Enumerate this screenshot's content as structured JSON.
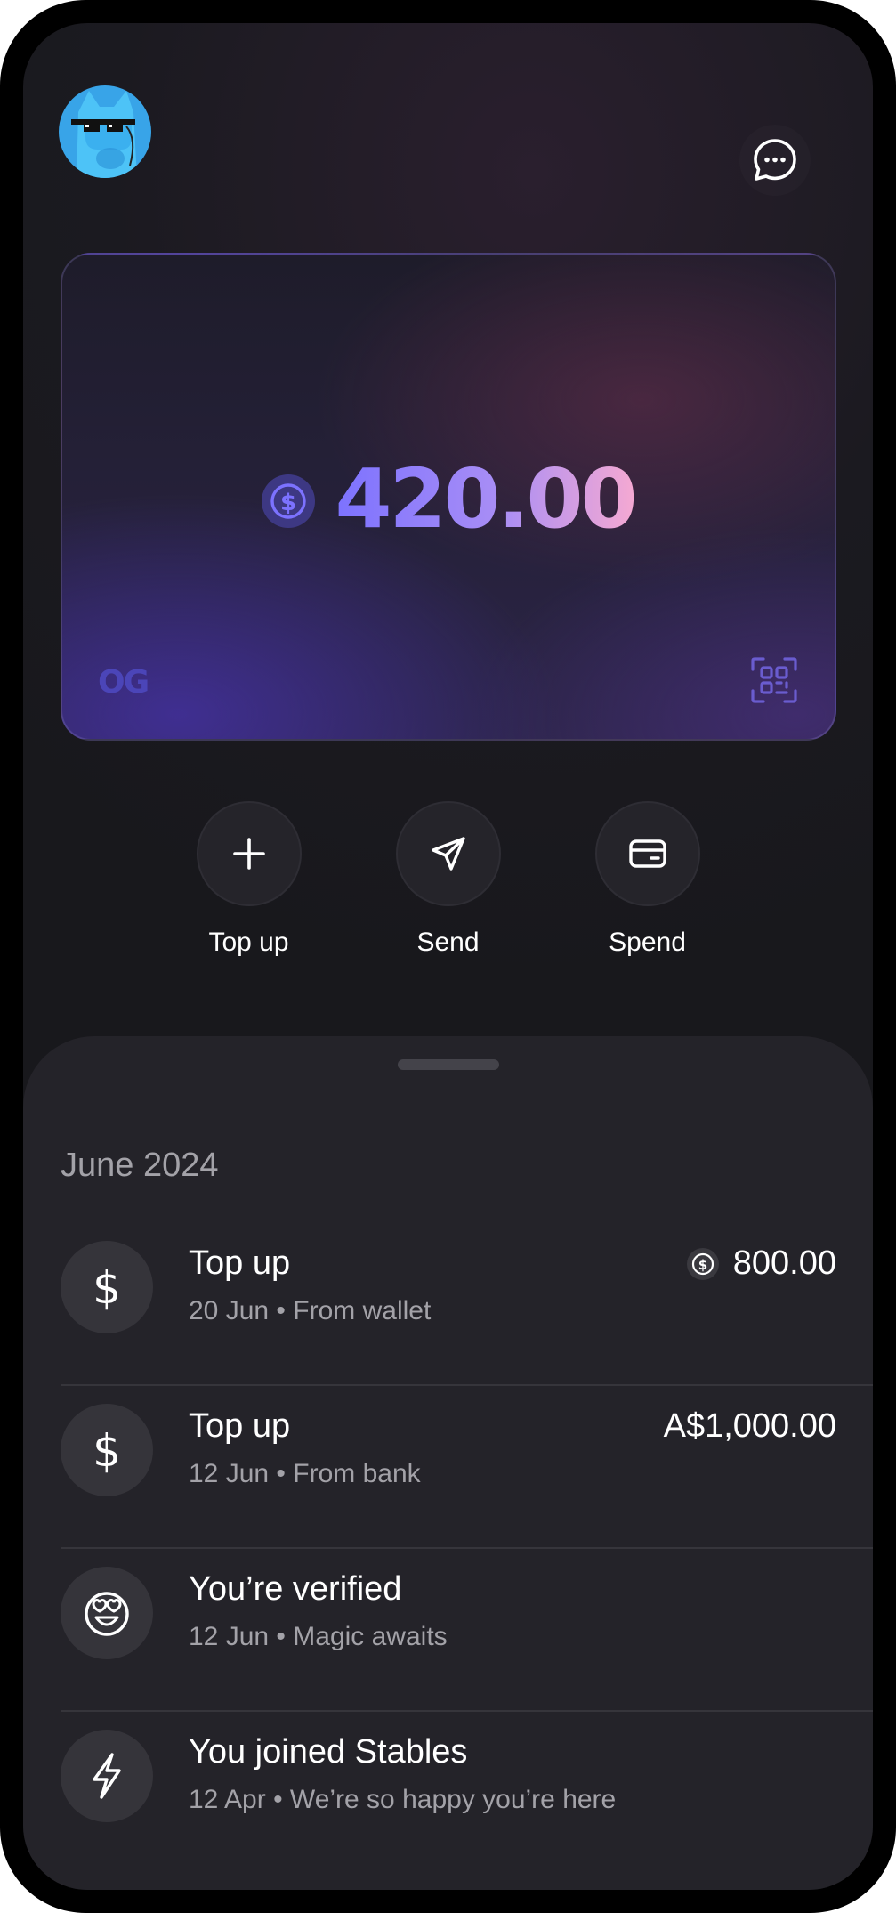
{
  "balance": {
    "amount": "420.00",
    "currency_icon": "usdc-icon",
    "card_brand": "OG"
  },
  "header": {
    "avatar": "cat-avatar",
    "chat_icon": "chat-bubble-icon"
  },
  "actions": [
    {
      "label": "Top up",
      "icon": "plus-icon"
    },
    {
      "label": "Send",
      "icon": "send-icon"
    },
    {
      "label": "Spend",
      "icon": "card-icon"
    }
  ],
  "activity": {
    "month": "June 2024",
    "transactions": [
      {
        "title": "Top up",
        "date": "20 Jun",
        "detail": "From wallet",
        "amount": "800.00",
        "currency_icon": "usdc-icon",
        "icon": "dollar-icon"
      },
      {
        "title": "Top up",
        "date": "12 Jun",
        "detail": "From bank",
        "amount": "A$1,000.00",
        "icon": "dollar-icon"
      },
      {
        "title": "You’re verified",
        "date": "12 Jun",
        "detail": "Magic awaits",
        "amount": "",
        "icon": "heart-eyes-icon"
      },
      {
        "title": "You joined Stables",
        "date": "12 Apr",
        "detail": "We’re so happy you’re here",
        "amount": "",
        "icon": "lightning-icon"
      }
    ]
  },
  "colors": {
    "background": "#18181c",
    "sheet": "#242329",
    "accent_start": "#7c72ff",
    "accent_end": "#f5a9d2"
  }
}
